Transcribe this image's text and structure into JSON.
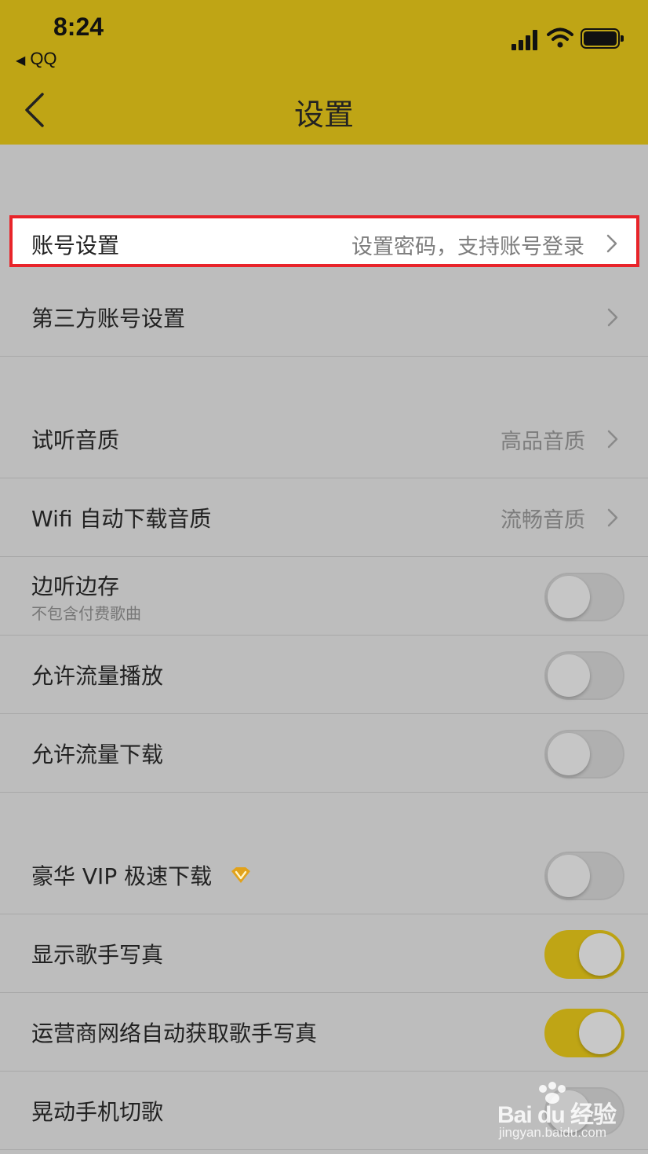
{
  "status_bar": {
    "time": "8:24",
    "back_app": "QQ",
    "back_arrow": "◀"
  },
  "nav": {
    "title": "设置",
    "back_icon": "chevron-left-icon"
  },
  "colors": {
    "accent": "#bfa515",
    "background": "#bdbdbd",
    "highlight_border": "#e8242a"
  },
  "rows": {
    "account": {
      "label": "账号设置",
      "value": "设置密码，支持账号登录"
    },
    "third_party": {
      "label": "第三方账号设置"
    },
    "preview_quality": {
      "label": "试听音质",
      "value": "高品音质"
    },
    "wifi_download_quality": {
      "label": "Wifi 自动下载音质",
      "value": "流畅音质"
    },
    "cache_while_play": {
      "label": "边听边存",
      "sublabel": "不包含付费歌曲",
      "on": false
    },
    "allow_data_play": {
      "label": "允许流量播放",
      "on": false
    },
    "allow_data_download": {
      "label": "允许流量下载",
      "on": false
    },
    "vip_fast_download": {
      "label": "豪华 VIP 极速下载",
      "icon": "vip-diamond-icon",
      "on": false
    },
    "show_singer_photo": {
      "label": "显示歌手写真",
      "on": true
    },
    "carrier_fetch_photo": {
      "label": "运营商网络自动获取歌手写真",
      "on": true
    },
    "shake_switch": {
      "label": "晃动手机切歌",
      "on": false
    }
  },
  "watermark": {
    "brand": "Bai du 经验",
    "url": "jingyan.baidu.com"
  }
}
